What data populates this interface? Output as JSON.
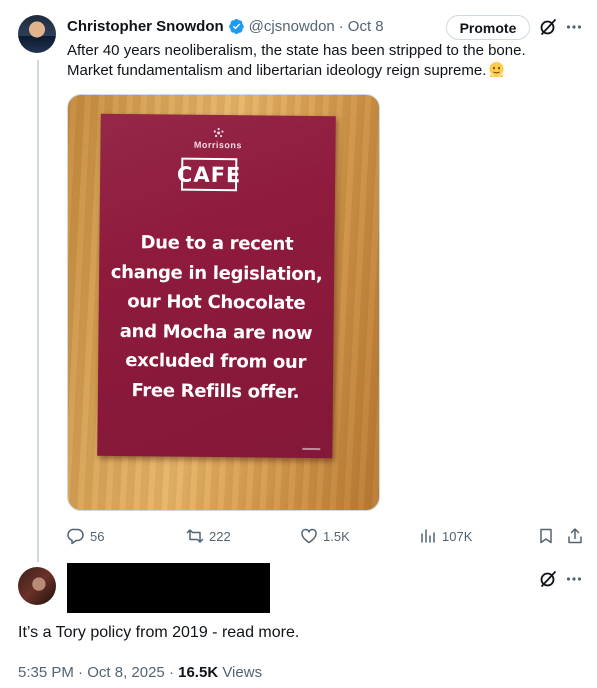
{
  "tweet": {
    "author_name": "Christopher Snowdon",
    "handle": "@cjsnowdon",
    "separator": "·",
    "date": "Oct 8",
    "promote_label": "Promote",
    "text_line_1": "After 40 years neoliberalism, the state has been stripped to the bone.",
    "text_line_2": "Market fundamentalism and libertarian ideology reign supreme.",
    "emoji": "melting-face-emoji",
    "image": {
      "brand": "Morrisons",
      "cafe_label": "CAFE",
      "lines": [
        "Due to a recent",
        "change in legislation,",
        "our Hot Chocolate",
        "and Mocha are now",
        "excluded from our",
        "Free Refills offer."
      ]
    },
    "actions": {
      "replies": "56",
      "reposts": "222",
      "likes": "1.5K",
      "views": "107K"
    }
  },
  "reply": {
    "text": "It’s a Tory policy from 2019 - read more.",
    "time": "5:35 PM",
    "separator": "·",
    "date": "Oct 8, 2025",
    "views_count": "16.5K",
    "views_label": "Views"
  },
  "colors": {
    "text_primary": "#0f1419",
    "text_secondary": "#536471",
    "verified_blue": "#1d9bf0",
    "poster_maroon": "#8e1a3c",
    "border": "#cfd9de"
  }
}
